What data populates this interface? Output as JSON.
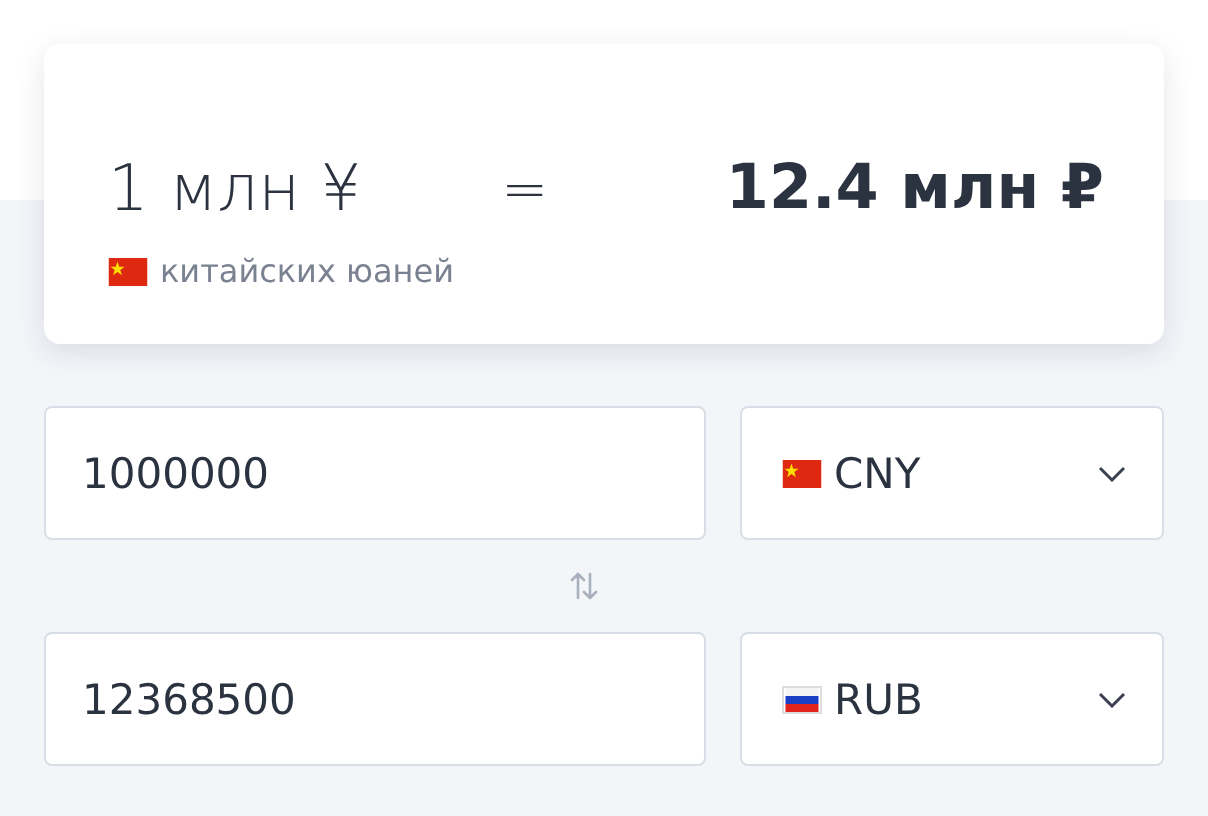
{
  "summary": {
    "amount": "1 млн ¥",
    "equals": "=",
    "result": "12.4 млн ₽",
    "kind": "cn",
    "currency_name": "китайских юаней"
  },
  "converter": [
    {
      "value": "1000000",
      "kind": "cn",
      "currency": "CNY"
    },
    {
      "value": "12368500",
      "kind": "ru",
      "currency": "RUB"
    }
  ]
}
